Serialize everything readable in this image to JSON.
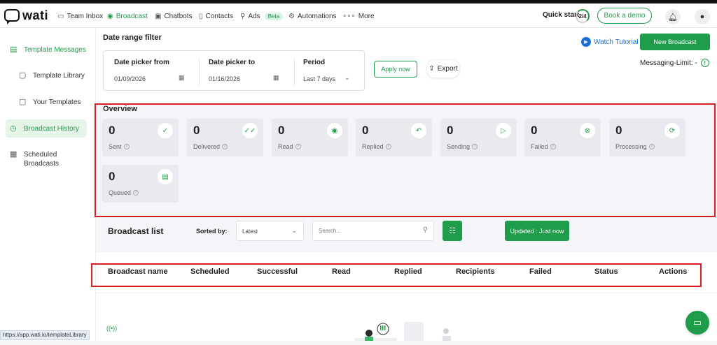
{
  "brand": {
    "name": "wati"
  },
  "nav": {
    "items": [
      {
        "label": "Team Inbox",
        "icon": "inbox-icon"
      },
      {
        "label": "Broadcast",
        "icon": "broadcast-icon",
        "active": true
      },
      {
        "label": "Chatbots",
        "icon": "bot-icon"
      },
      {
        "label": "Contacts",
        "icon": "contacts-icon"
      },
      {
        "label": "Ads",
        "icon": "ads-icon",
        "badge": "Beta"
      },
      {
        "label": "Automations",
        "icon": "gear-icon"
      },
      {
        "label": "More",
        "icon": "dots-icon"
      }
    ],
    "quick_start": "Quick start",
    "quick_progress": "2/4",
    "book_demo": "Book a demo"
  },
  "sidebar": {
    "items": [
      {
        "label": "Template Messages"
      },
      {
        "label": "Template Library"
      },
      {
        "label": "Your Templates"
      },
      {
        "label": "Broadcast History",
        "active": true
      },
      {
        "label": "Scheduled Broadcasts"
      }
    ]
  },
  "status_url": "https://app.wati.io/templateLibrary",
  "filter": {
    "title": "Date range filter",
    "from_label": "Date picker from",
    "from_value": "01/09/2026",
    "to_label": "Date picker to",
    "to_value": "01/16/2026",
    "period_label": "Period",
    "period_value": "Last 7 days",
    "apply": "Apply now",
    "export": "Export"
  },
  "header_actions": {
    "watch_tutorial": "Watch Tutorial",
    "new_broadcast": "New Broadcast",
    "messaging_limit": "Messaging-Limit: -"
  },
  "overview": {
    "title": "Overview",
    "cards": [
      {
        "value": "0",
        "label": "Sent",
        "icon": "check-icon"
      },
      {
        "value": "0",
        "label": "Delivered",
        "icon": "double-check-icon"
      },
      {
        "value": "0",
        "label": "Read",
        "icon": "eye-icon"
      },
      {
        "value": "0",
        "label": "Replied",
        "icon": "reply-icon"
      },
      {
        "value": "0",
        "label": "Sending",
        "icon": "send-icon"
      },
      {
        "value": "0",
        "label": "Failed",
        "icon": "failed-icon"
      },
      {
        "value": "0",
        "label": "Processing",
        "icon": "refresh-icon"
      },
      {
        "value": "0",
        "label": "Queued",
        "icon": "queue-icon"
      }
    ]
  },
  "broadcast_list": {
    "title": "Broadcast list",
    "sorted_by": "Sorted by:",
    "sort_value": "Latest",
    "search_placeholder": "Search...",
    "updated": "Updated : Just now",
    "columns": [
      "Broadcast name",
      "Scheduled",
      "Successful",
      "Read",
      "Replied",
      "Recipients",
      "Failed",
      "Status",
      "Actions"
    ]
  },
  "colors": {
    "accent": "#1f9c4a",
    "highlight": "#d81e1e",
    "link": "#1a6fd6"
  }
}
